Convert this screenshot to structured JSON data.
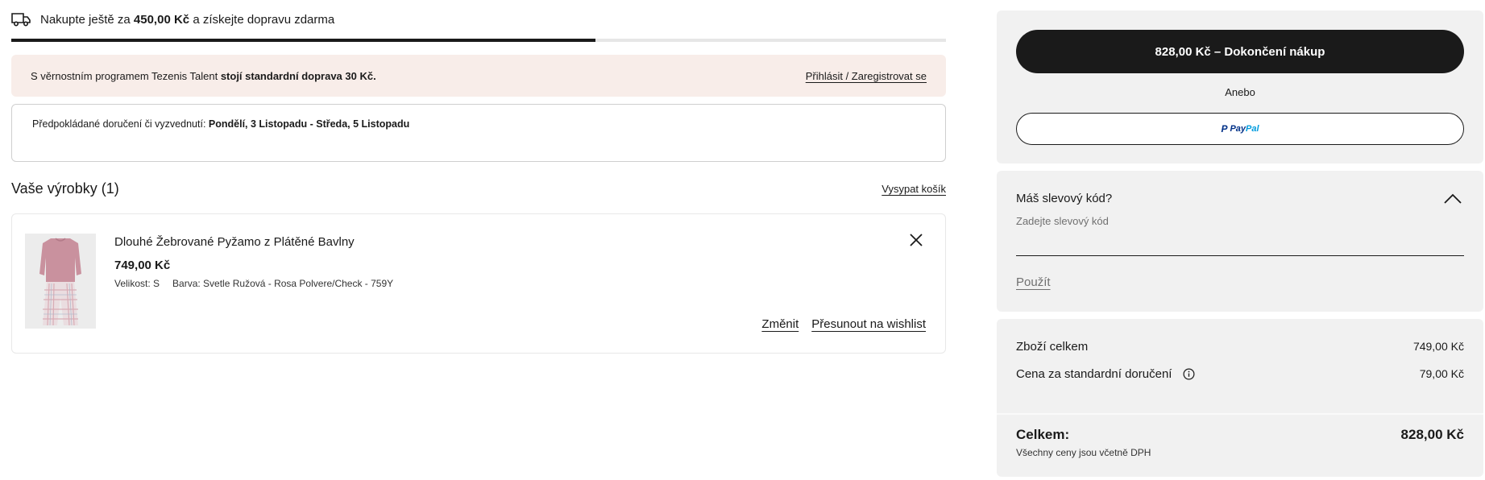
{
  "shipping": {
    "prefix": "Nakupte ještě za",
    "amount": "450,00 Kč",
    "suffix": "a získejte dopravu zdarma",
    "progress_fraction": 0.625
  },
  "loyalty": {
    "text": "S věrnostním programem Tezenis Talent",
    "bold": "stojí standardní doprava 30 Kč.",
    "link": "Přihlásit / Zaregistrovat se"
  },
  "delivery": {
    "label": "Předpokládané doručení či vyzvednutí:",
    "dates": "Pondělí, 3 Listopadu - Středa, 5 Listopadu"
  },
  "items": {
    "title": "Vaše výrobky (1)",
    "empty_link": "Vysypat košík",
    "list": [
      {
        "name": "Dlouhé Žebrované Pyžamo z Plátěné Bavlny",
        "price": "749,00 Kč",
        "size": "Velikost: S",
        "color": "Barva: Svetle Ružová - Rosa Polvere/Check - 759Y",
        "change": "Změnit",
        "wishlist": "Přesunout na wishlist"
      }
    ]
  },
  "checkout": {
    "button": "828,00 Kč – Dokončení nákup",
    "or": "Anebo",
    "paypal_pay": "Pay",
    "paypal_pal": "Pal"
  },
  "discount": {
    "title": "Máš slevový kód?",
    "placeholder": "Zadejte slevový kód",
    "apply": "Použít"
  },
  "summary": {
    "goods_label": "Zboží celkem",
    "goods_value": "749,00 Kč",
    "shipping_label": "Cena za standardní doručení",
    "shipping_value": "79,00 Kč",
    "total_label": "Celkem:",
    "total_value": "828,00 Kč",
    "vat_note": "Všechny ceny jsou včetně DPH"
  },
  "colors": {
    "accent": "#1a1a1a",
    "loyalty_bg": "#f8ede9",
    "panel_bg": "#f1f1f1",
    "paypal_dark": "#003087",
    "paypal_light": "#009cde"
  }
}
